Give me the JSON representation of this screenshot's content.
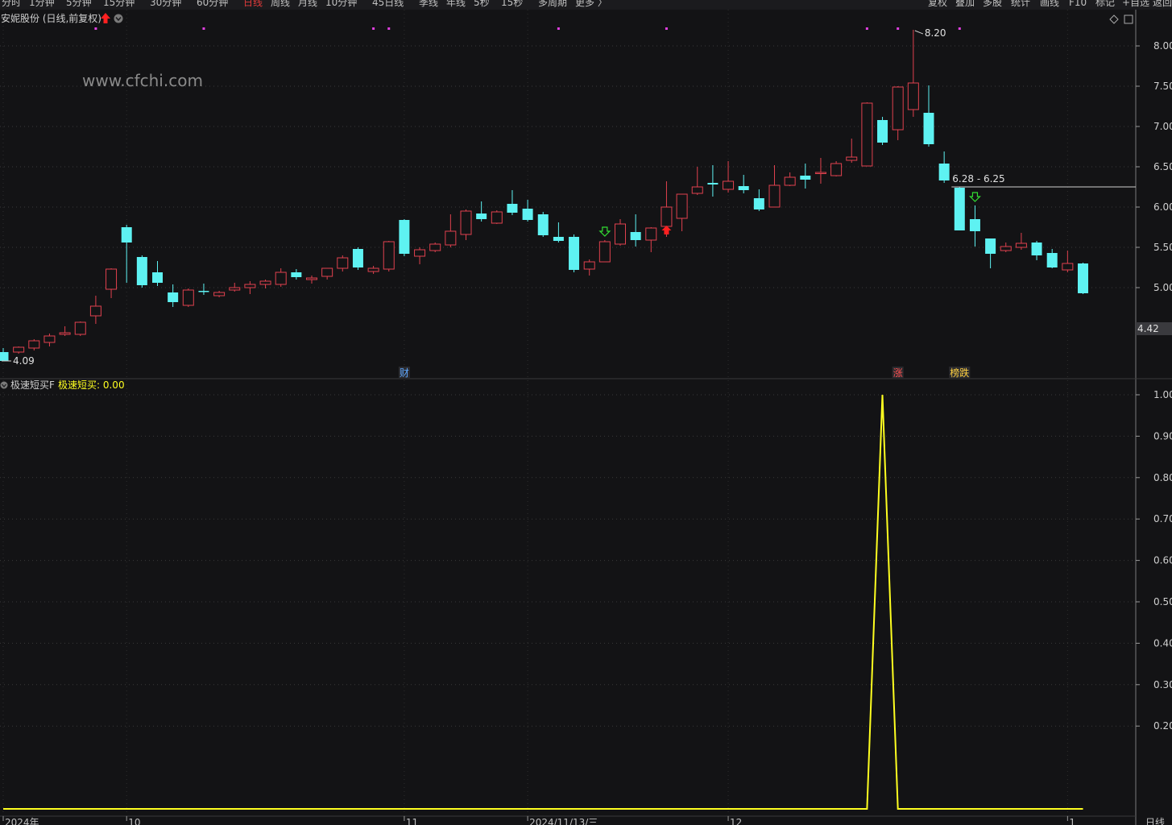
{
  "toolbar": {
    "left_items": [
      "分时",
      "1分钟",
      "5分钟",
      "15分钟",
      "30分钟",
      "60分钟",
      "日线",
      "周线",
      "月线",
      "10分钟",
      "45日线",
      "季线",
      "年线",
      "5秒",
      "15秒",
      "多周期",
      "更多 〉"
    ],
    "active": "日线",
    "right_items": [
      "复权",
      "叠加",
      "多股",
      "统计",
      "画线",
      "F10",
      "标记",
      "+自选",
      "返回"
    ]
  },
  "main_panel": {
    "title": "安妮股份 (日线,前复权)",
    "watermark": "www.cfchi.com",
    "high_label": "8.20",
    "low_label": "4.09",
    "range_label": "6.28 - 6.25",
    "last_price_tag": "4.42",
    "events": [
      {
        "idx": 26,
        "text": "财",
        "color": "#5fa8ff"
      },
      {
        "idx": 58,
        "text": "涨",
        "color": "#ff5050"
      },
      {
        "idx": 62,
        "text": "榜跌",
        "color": "#ffd040"
      }
    ],
    "arrows": [
      {
        "idx": 39,
        "dir": "down",
        "color": "#33dd33"
      },
      {
        "idx": 43,
        "dir": "up",
        "color": "#ff2020"
      },
      {
        "idx": 63,
        "dir": "down",
        "color": "#33dd33"
      }
    ],
    "markers_idx": [
      6,
      13,
      24,
      25,
      36,
      43,
      56,
      58,
      62
    ]
  },
  "indicator_panel": {
    "name": "极速短买F",
    "value_label": "极速短买: 0.00"
  },
  "x_axis_labels": [
    {
      "idx": 0,
      "text": "2024年"
    },
    {
      "idx": 8,
      "text": "10"
    },
    {
      "idx": 26,
      "text": "11"
    },
    {
      "idx": 34,
      "text": "2024/11/13/三"
    },
    {
      "idx": 47,
      "text": "12"
    },
    {
      "idx": 69,
      "text": "1"
    }
  ],
  "x_axis_right": "日线",
  "colors": {
    "up": "#e0414e",
    "down": "#5ef2f2",
    "line": "#ffff20",
    "background": "#131315"
  },
  "chart_data": [
    {
      "type": "candlestick",
      "y_ticks": [
        5.0,
        5.5,
        6.0,
        6.5,
        7.0,
        7.5,
        8.0
      ],
      "ylim": [
        4.0,
        8.3
      ],
      "candles": [
        [
          4.2,
          4.09,
          4.25,
          4.09
        ],
        [
          4.2,
          4.26,
          4.27,
          4.18
        ],
        [
          4.25,
          4.34,
          4.36,
          4.22
        ],
        [
          4.32,
          4.4,
          4.43,
          4.27
        ],
        [
          4.42,
          4.44,
          4.52,
          4.4
        ],
        [
          4.42,
          4.57,
          4.58,
          4.4
        ],
        [
          4.65,
          4.77,
          4.9,
          4.55
        ],
        [
          4.98,
          5.23,
          5.24,
          4.87
        ],
        [
          5.75,
          5.56,
          5.78,
          5.06
        ],
        [
          5.38,
          5.03,
          5.4,
          5.0
        ],
        [
          5.19,
          5.06,
          5.33,
          5.02
        ],
        [
          4.94,
          4.82,
          5.04,
          4.76
        ],
        [
          4.78,
          4.97,
          4.99,
          4.76
        ],
        [
          4.96,
          4.95,
          5.05,
          4.91
        ],
        [
          4.9,
          4.94,
          4.96,
          4.88
        ],
        [
          4.97,
          5.0,
          5.06,
          4.95
        ],
        [
          5.0,
          5.04,
          5.08,
          4.92
        ],
        [
          5.04,
          5.08,
          5.1,
          4.99
        ],
        [
          5.04,
          5.19,
          5.24,
          5.01
        ],
        [
          5.19,
          5.13,
          5.23,
          5.1
        ],
        [
          5.1,
          5.12,
          5.15,
          5.05
        ],
        [
          5.14,
          5.24,
          5.24,
          5.1
        ],
        [
          5.24,
          5.37,
          5.4,
          5.2
        ],
        [
          5.48,
          5.25,
          5.5,
          5.22
        ],
        [
          5.2,
          5.24,
          5.27,
          5.17
        ],
        [
          5.23,
          5.57,
          5.58,
          5.2
        ],
        [
          5.84,
          5.42,
          5.85,
          5.39
        ],
        [
          5.39,
          5.47,
          5.5,
          5.29
        ],
        [
          5.46,
          5.54,
          5.56,
          5.44
        ],
        [
          5.53,
          5.7,
          5.91,
          5.5
        ],
        [
          5.66,
          5.95,
          5.97,
          5.59
        ],
        [
          5.92,
          5.85,
          6.07,
          5.82
        ],
        [
          5.8,
          5.94,
          5.96,
          5.79
        ],
        [
          6.04,
          5.93,
          6.21,
          5.9
        ],
        [
          5.98,
          5.84,
          6.09,
          5.82
        ],
        [
          5.91,
          5.65,
          5.94,
          5.63
        ],
        [
          5.63,
          5.58,
          5.81,
          5.56
        ],
        [
          5.63,
          5.22,
          5.66,
          5.19
        ],
        [
          5.23,
          5.32,
          5.35,
          5.15
        ],
        [
          5.32,
          5.57,
          5.59,
          5.32
        ],
        [
          5.54,
          5.79,
          5.85,
          5.52
        ],
        [
          5.69,
          5.59,
          5.91,
          5.51
        ],
        [
          5.59,
          5.74,
          5.75,
          5.44
        ],
        [
          5.76,
          6.0,
          6.32,
          5.63
        ],
        [
          5.86,
          6.16,
          6.15,
          5.7
        ],
        [
          6.17,
          6.25,
          6.5,
          6.15
        ],
        [
          6.3,
          6.28,
          6.52,
          6.13
        ],
        [
          6.22,
          6.32,
          6.57,
          6.18
        ],
        [
          6.26,
          6.21,
          6.4,
          6.17
        ],
        [
          6.11,
          5.97,
          6.22,
          5.95
        ],
        [
          6.0,
          6.27,
          6.52,
          6.0
        ],
        [
          6.27,
          6.37,
          6.43,
          6.26
        ],
        [
          6.39,
          6.34,
          6.54,
          6.23
        ],
        [
          6.43,
          6.43,
          6.61,
          6.29
        ],
        [
          6.39,
          6.54,
          6.57,
          6.38
        ],
        [
          6.58,
          6.62,
          6.85,
          6.55
        ],
        [
          6.51,
          7.29,
          7.3,
          6.51
        ],
        [
          7.08,
          6.8,
          7.12,
          6.77
        ],
        [
          6.96,
          7.49,
          7.5,
          6.83
        ],
        [
          7.21,
          7.54,
          8.2,
          7.12
        ],
        [
          7.17,
          6.78,
          7.51,
          6.75
        ],
        [
          6.54,
          6.33,
          6.69,
          6.3
        ],
        [
          6.24,
          5.71,
          6.25,
          5.71
        ],
        [
          5.85,
          5.7,
          6.02,
          5.51
        ],
        [
          5.61,
          5.42,
          5.61,
          5.24
        ],
        [
          5.46,
          5.51,
          5.56,
          5.44
        ],
        [
          5.5,
          5.55,
          5.68,
          5.47
        ],
        [
          5.56,
          5.4,
          5.58,
          5.34
        ],
        [
          5.43,
          5.25,
          5.48,
          5.24
        ],
        [
          5.22,
          5.3,
          5.46,
          5.19
        ],
        [
          5.3,
          4.93,
          5.31,
          4.92
        ]
      ]
    },
    {
      "type": "line",
      "name": "极速短买",
      "y_ticks": [
        0.2,
        0.3,
        0.4,
        0.5,
        0.6,
        0.7,
        0.8,
        0.9,
        1.0
      ],
      "ylim": [
        0,
        1.03
      ],
      "values": [
        0,
        0,
        0,
        0,
        0,
        0,
        0,
        0,
        0,
        0,
        0,
        0,
        0,
        0,
        0,
        0,
        0,
        0,
        0,
        0,
        0,
        0,
        0,
        0,
        0,
        0,
        0,
        0,
        0,
        0,
        0,
        0,
        0,
        0,
        0,
        0,
        0,
        0,
        0,
        0,
        0,
        0,
        0,
        0,
        0,
        0,
        0,
        0,
        0,
        0,
        0,
        0,
        0,
        0,
        0,
        0,
        0,
        1,
        0,
        0,
        0,
        0,
        0,
        0,
        0,
        0,
        0,
        0,
        0,
        0,
        0
      ]
    }
  ]
}
